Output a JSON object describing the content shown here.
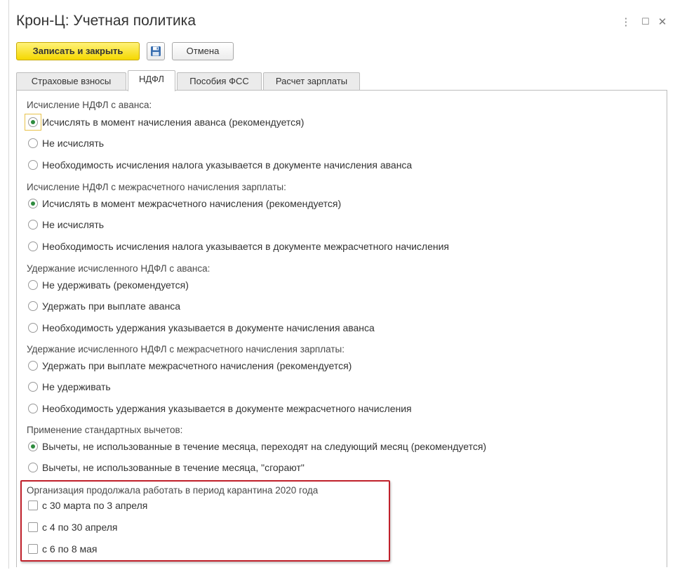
{
  "window": {
    "title": "Крон-Ц: Учетная политика",
    "controls": {
      "more": "⋮",
      "maximize": "☐",
      "close": "✕"
    }
  },
  "toolbar": {
    "save_close_label": "Записать и закрыть",
    "save_icon": "floppy-disk-icon",
    "cancel_label": "Отмена"
  },
  "tabs": [
    {
      "label": "Страховые взносы",
      "active": false
    },
    {
      "label": "НДФЛ",
      "active": true
    },
    {
      "label": "Пособия ФСС",
      "active": false
    },
    {
      "label": "Расчет зарплаты",
      "active": false
    }
  ],
  "groups": [
    {
      "label": "Исчисление НДФЛ с аванса:",
      "options": [
        {
          "text": "Исчислять в момент начисления аванса (рекомендуется)",
          "selected": true
        },
        {
          "text": "Не исчислять",
          "selected": false
        },
        {
          "text": "Необходимость исчисления налога указывается в документе начисления аванса",
          "selected": false
        }
      ]
    },
    {
      "label": "Исчисление НДФЛ с межрасчетного начисления зарплаты:",
      "options": [
        {
          "text": "Исчислять в момент межрасчетного начисления (рекомендуется)",
          "selected": true
        },
        {
          "text": "Не исчислять",
          "selected": false
        },
        {
          "text": "Необходимость исчисления налога указывается в документе межрасчетного начисления",
          "selected": false
        }
      ]
    },
    {
      "label": "Удержание исчисленного НДФЛ с аванса:",
      "options": [
        {
          "text": "Не удерживать (рекомендуется)",
          "selected": false
        },
        {
          "text": "Удержать при выплате аванса",
          "selected": false
        },
        {
          "text": "Необходимость удержания указывается в документе начисления аванса",
          "selected": false
        }
      ]
    },
    {
      "label": "Удержание исчисленного НДФЛ с межрасчетного начисления зарплаты:",
      "options": [
        {
          "text": "Удержать при выплате межрасчетного начисления (рекомендуется)",
          "selected": false
        },
        {
          "text": "Не удерживать",
          "selected": false
        },
        {
          "text": "Необходимость удержания указывается в документе межрасчетного начисления",
          "selected": false
        }
      ]
    },
    {
      "label": "Применение стандартных вычетов:",
      "options": [
        {
          "text": "Вычеты, не использованные в течение месяца, переходят на следующий месяц (рекомендуется)",
          "selected": true
        },
        {
          "text": "Вычеты, не использованные в течение месяца, \"сгорают\"",
          "selected": false
        }
      ]
    }
  ],
  "quarantine": {
    "label": "Организация продолжала работать в период карантина 2020 года",
    "checkboxes": [
      {
        "text": "с 30 марта по 3 апреля",
        "checked": false
      },
      {
        "text": "с 4 по 30 апреля",
        "checked": false
      },
      {
        "text": "с 6 по 8 мая",
        "checked": false
      }
    ]
  },
  "colors": {
    "primary_button": "#f5d800",
    "radio_selected": "#2e8b3e",
    "highlight_frame": "#c0202a"
  }
}
